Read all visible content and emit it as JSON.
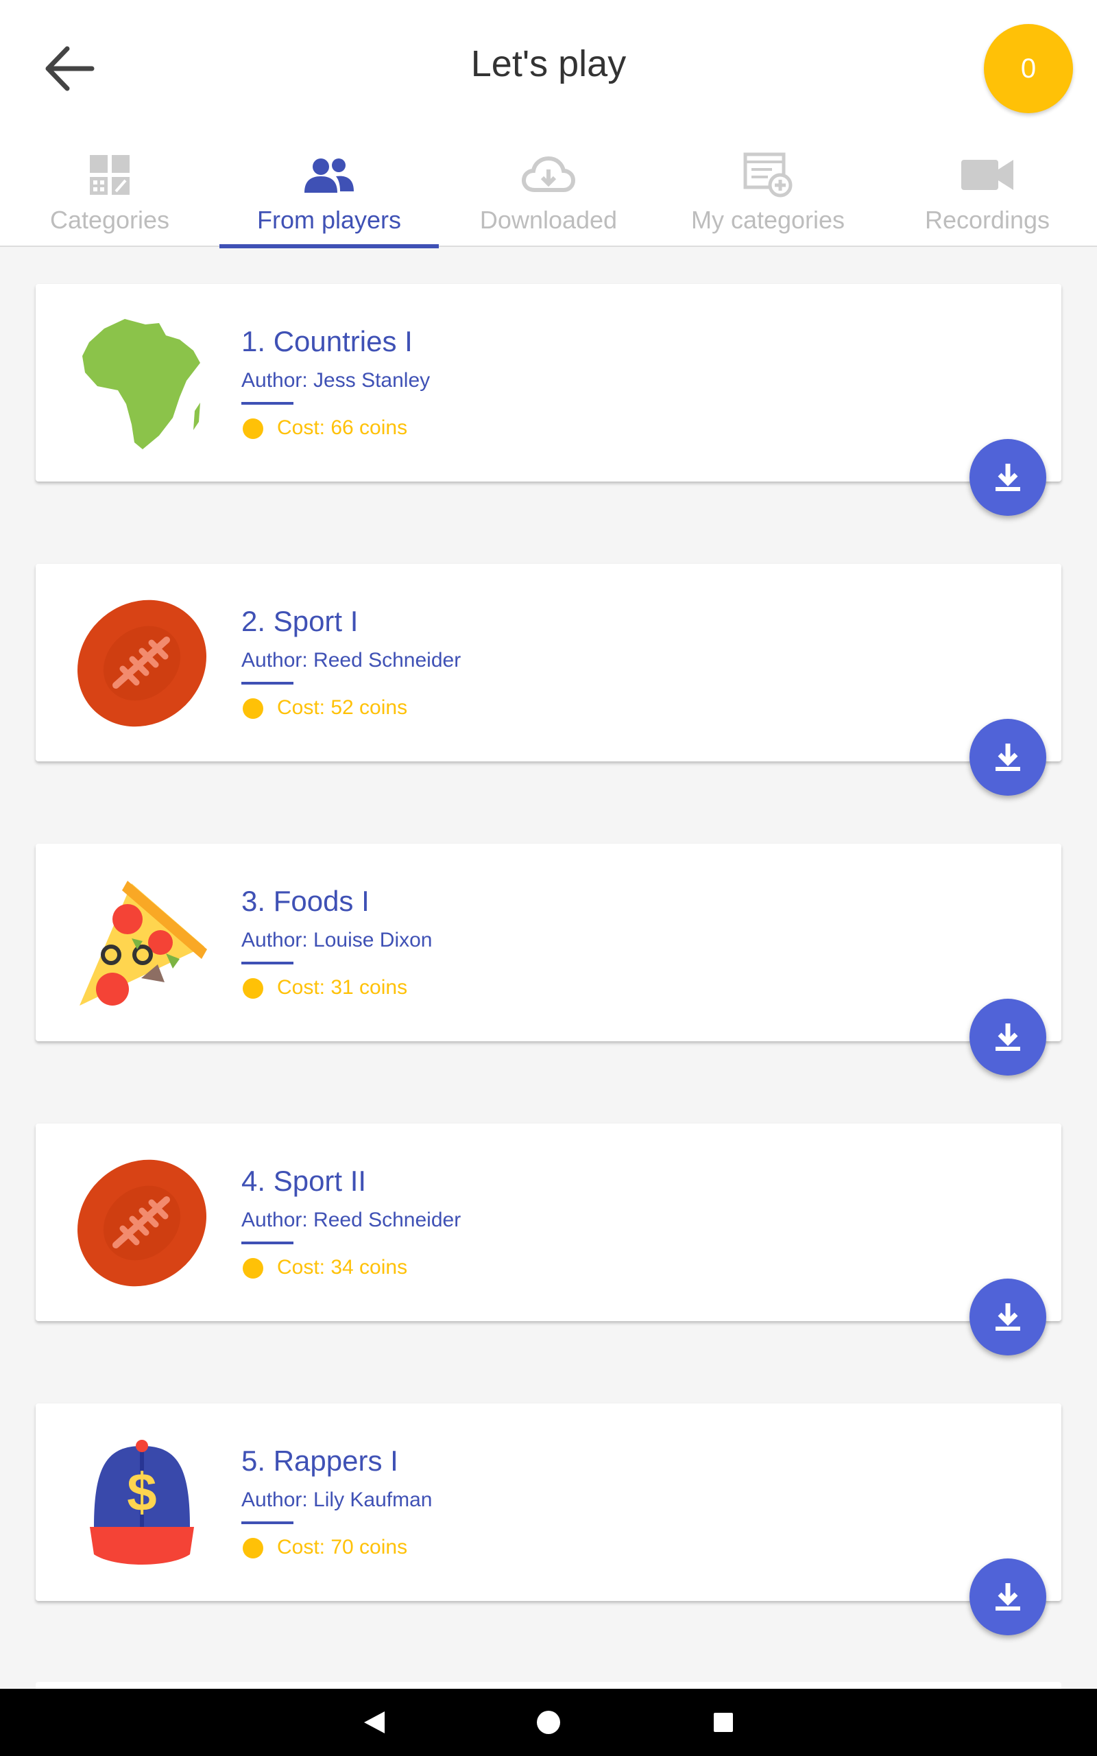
{
  "header": {
    "title": "Let's play",
    "coins": "0"
  },
  "tabs": [
    {
      "label": "Categories",
      "icon": "categories-grid-icon",
      "active": false
    },
    {
      "label": "From players",
      "icon": "people-icon",
      "active": true
    },
    {
      "label": "Downloaded",
      "icon": "cloud-download-icon",
      "active": false
    },
    {
      "label": "My categories",
      "icon": "add-category-icon",
      "active": false
    },
    {
      "label": "Recordings",
      "icon": "video-camera-icon",
      "active": false
    }
  ],
  "items": [
    {
      "name": "1. Countries I",
      "author": "Author: Jess Stanley",
      "cost": "Cost: 66 coins",
      "icon": "africa-map-icon"
    },
    {
      "name": "2. Sport I",
      "author": "Author: Reed Schneider",
      "cost": "Cost: 52 coins",
      "icon": "football-icon"
    },
    {
      "name": "3. Foods I",
      "author": "Author: Louise Dixon",
      "cost": "Cost: 31 coins",
      "icon": "pizza-slice-icon"
    },
    {
      "name": "4. Sport II",
      "author": "Author: Reed Schneider",
      "cost": "Cost: 34 coins",
      "icon": "football-icon"
    },
    {
      "name": "5. Rappers I",
      "author": "Author: Lily Kaufman",
      "cost": "Cost: 70 coins",
      "icon": "dollar-cap-icon"
    }
  ],
  "colors": {
    "primary": "#3F51B5",
    "accent_button": "#5063D8",
    "coin": "#FFC107",
    "inactive_tab": "#BDBDBD"
  }
}
